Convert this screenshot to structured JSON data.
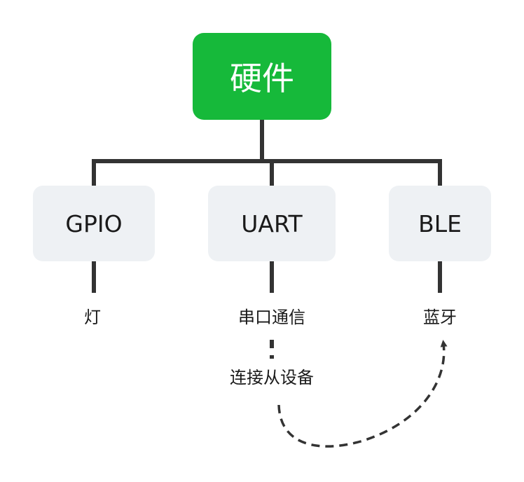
{
  "colors": {
    "root_fill": "#16b93a",
    "child_fill": "#eef1f4",
    "line": "#333333"
  },
  "root": {
    "label": "硬件"
  },
  "children": [
    {
      "label": "GPIO",
      "leaf": "灯"
    },
    {
      "label": "UART",
      "leaf": "串口通信",
      "leaf2": "连接从设备"
    },
    {
      "label": "BLE",
      "leaf": "蓝牙"
    }
  ]
}
